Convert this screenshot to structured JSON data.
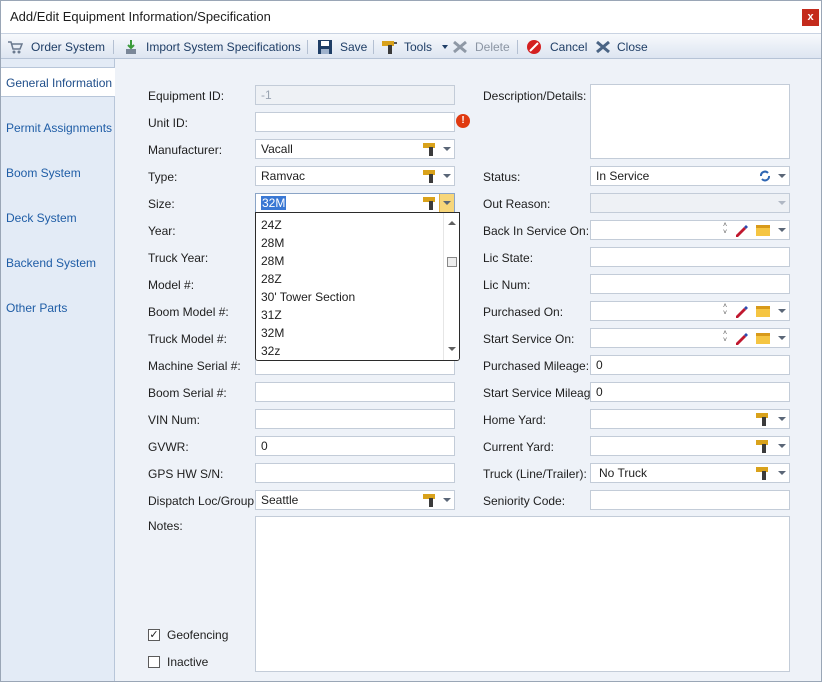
{
  "window": {
    "title": "Add/Edit Equipment Information/Specification",
    "close_glyph": "x"
  },
  "toolbar": {
    "order_system": "Order System",
    "import_specs": "Import System Specifications",
    "save": "Save",
    "tools": "Tools",
    "delete": "Delete",
    "cancel": "Cancel",
    "close": "Close"
  },
  "tabs": [
    "General Information",
    "Permit Assignments",
    "Boom System",
    "Deck System",
    "Backend System",
    "Other Parts"
  ],
  "form": {
    "left": {
      "equipment_id": {
        "label": "Equipment ID:",
        "value": "-1"
      },
      "unit_id": {
        "label": "Unit ID:",
        "value": ""
      },
      "manufacturer": {
        "label": "Manufacturer:",
        "value": "Vacall"
      },
      "type": {
        "label": "Type:",
        "value": "Ramvac"
      },
      "size": {
        "label": "Size:",
        "value": "32M"
      },
      "year": {
        "label": "Year:"
      },
      "truck_year": {
        "label": "Truck Year:"
      },
      "model": {
        "label": "Model #:"
      },
      "boom_model": {
        "label": "Boom Model #:"
      },
      "truck_model": {
        "label": "Truck Model #:"
      },
      "machine_serial": {
        "label": "Machine Serial #:",
        "value": ""
      },
      "boom_serial": {
        "label": "Boom Serial #:",
        "value": ""
      },
      "vin": {
        "label": "VIN Num:",
        "value": ""
      },
      "gvwr": {
        "label": "GVWR:",
        "value": "0"
      },
      "gps": {
        "label": "GPS HW S/N:",
        "value": ""
      },
      "dispatch": {
        "label": "Dispatch Loc/Group:",
        "value": "Seattle"
      },
      "notes": {
        "label": "Notes:"
      }
    },
    "right": {
      "description": {
        "label": "Description/Details:"
      },
      "status": {
        "label": "Status:",
        "value": "In Service"
      },
      "out_reason": {
        "label": "Out Reason:",
        "value": ""
      },
      "back_in_service": {
        "label": "Back In Service On:"
      },
      "lic_state": {
        "label": "Lic State:"
      },
      "lic_num": {
        "label": "Lic Num:"
      },
      "purchased_on": {
        "label": "Purchased On:"
      },
      "start_service_on": {
        "label": "Start Service On:"
      },
      "purchased_mileage": {
        "label": "Purchased Mileage:",
        "value": "0"
      },
      "start_service_mileage": {
        "label": "Start Service Mileage:",
        "value": "0"
      },
      "home_yard": {
        "label": "Home Yard:",
        "value": ""
      },
      "current_yard": {
        "label": "Current Yard:",
        "value": ""
      },
      "truck_line_trailer": {
        "label": "Truck (Line/Trailer):",
        "value": "No Truck"
      },
      "seniority_code": {
        "label": "Seniority Code:",
        "value": ""
      }
    },
    "checkboxes": {
      "geofencing": {
        "label": "Geofencing",
        "checked": true
      },
      "inactive": {
        "label": "Inactive",
        "checked": false
      }
    }
  },
  "size_dropdown": {
    "options": [
      "24Z",
      "28M",
      "28M",
      "28Z",
      "30' Tower Section",
      "31Z",
      "32M",
      "32z"
    ]
  }
}
